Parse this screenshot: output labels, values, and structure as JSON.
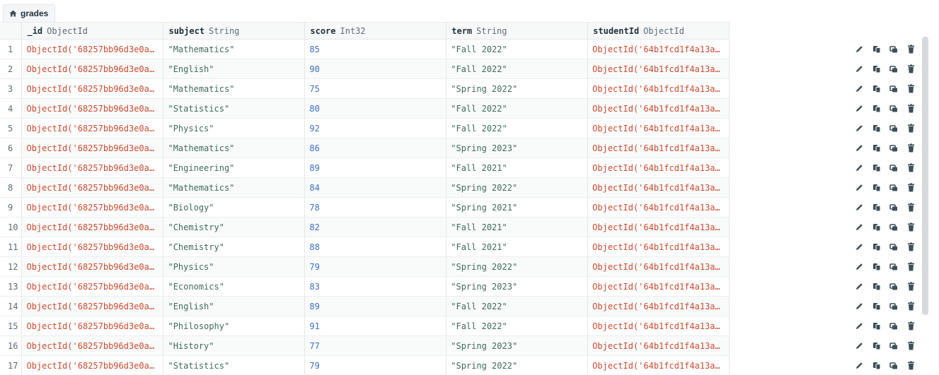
{
  "tab": {
    "label": "grades",
    "icon": "house-icon"
  },
  "columns": [
    {
      "field": "_id",
      "type": "ObjectId"
    },
    {
      "field": "subject",
      "type": "String"
    },
    {
      "field": "score",
      "type": "Int32"
    },
    {
      "field": "term",
      "type": "String"
    },
    {
      "field": "studentId",
      "type": "ObjectId"
    }
  ],
  "rows": [
    {
      "n": "1",
      "id": "ObjectId('68257bb96d3e0a…",
      "subject": "\"Mathematics\"",
      "score": "85",
      "term": "\"Fall 2022\"",
      "studentId": "ObjectId('64b1fcd1f4a13a…"
    },
    {
      "n": "2",
      "id": "ObjectId('68257bb96d3e0a…",
      "subject": "\"English\"",
      "score": "90",
      "term": "\"Fall 2022\"",
      "studentId": "ObjectId('64b1fcd1f4a13a…"
    },
    {
      "n": "3",
      "id": "ObjectId('68257bb96d3e0a…",
      "subject": "\"Mathematics\"",
      "score": "75",
      "term": "\"Spring 2022\"",
      "studentId": "ObjectId('64b1fcd1f4a13a…"
    },
    {
      "n": "4",
      "id": "ObjectId('68257bb96d3e0a…",
      "subject": "\"Statistics\"",
      "score": "80",
      "term": "\"Fall 2022\"",
      "studentId": "ObjectId('64b1fcd1f4a13a…"
    },
    {
      "n": "5",
      "id": "ObjectId('68257bb96d3e0a…",
      "subject": "\"Physics\"",
      "score": "92",
      "term": "\"Fall 2022\"",
      "studentId": "ObjectId('64b1fcd1f4a13a…"
    },
    {
      "n": "6",
      "id": "ObjectId('68257bb96d3e0a…",
      "subject": "\"Mathematics\"",
      "score": "86",
      "term": "\"Spring 2023\"",
      "studentId": "ObjectId('64b1fcd1f4a13a…"
    },
    {
      "n": "7",
      "id": "ObjectId('68257bb96d3e0a…",
      "subject": "\"Engineering\"",
      "score": "89",
      "term": "\"Fall 2021\"",
      "studentId": "ObjectId('64b1fcd1f4a13a…"
    },
    {
      "n": "8",
      "id": "ObjectId('68257bb96d3e0a…",
      "subject": "\"Mathematics\"",
      "score": "84",
      "term": "\"Spring 2022\"",
      "studentId": "ObjectId('64b1fcd1f4a13a…"
    },
    {
      "n": "9",
      "id": "ObjectId('68257bb96d3e0a…",
      "subject": "\"Biology\"",
      "score": "78",
      "term": "\"Spring 2021\"",
      "studentId": "ObjectId('64b1fcd1f4a13a…"
    },
    {
      "n": "10",
      "id": "ObjectId('68257bb96d3e0a…",
      "subject": "\"Chemistry\"",
      "score": "82",
      "term": "\"Fall 2021\"",
      "studentId": "ObjectId('64b1fcd1f4a13a…"
    },
    {
      "n": "11",
      "id": "ObjectId('68257bb96d3e0a…",
      "subject": "\"Chemistry\"",
      "score": "88",
      "term": "\"Fall 2021\"",
      "studentId": "ObjectId('64b1fcd1f4a13a…"
    },
    {
      "n": "12",
      "id": "ObjectId('68257bb96d3e0a…",
      "subject": "\"Physics\"",
      "score": "79",
      "term": "\"Spring 2022\"",
      "studentId": "ObjectId('64b1fcd1f4a13a…"
    },
    {
      "n": "13",
      "id": "ObjectId('68257bb96d3e0a…",
      "subject": "\"Economics\"",
      "score": "83",
      "term": "\"Spring 2023\"",
      "studentId": "ObjectId('64b1fcd1f4a13a…"
    },
    {
      "n": "14",
      "id": "ObjectId('68257bb96d3e0a…",
      "subject": "\"English\"",
      "score": "89",
      "term": "\"Fall 2022\"",
      "studentId": "ObjectId('64b1fcd1f4a13a…"
    },
    {
      "n": "15",
      "id": "ObjectId('68257bb96d3e0a…",
      "subject": "\"Philosophy\"",
      "score": "91",
      "term": "\"Fall 2022\"",
      "studentId": "ObjectId('64b1fcd1f4a13a…"
    },
    {
      "n": "16",
      "id": "ObjectId('68257bb96d3e0a…",
      "subject": "\"History\"",
      "score": "77",
      "term": "\"Spring 2023\"",
      "studentId": "ObjectId('64b1fcd1f4a13a…"
    },
    {
      "n": "17",
      "id": "ObjectId('68257bb96d3e0a…",
      "subject": "\"Statistics\"",
      "score": "79",
      "term": "\"Spring 2022\"",
      "studentId": "ObjectId('64b1fcd1f4a13a…"
    }
  ],
  "row_actions": [
    "edit-icon",
    "copy-icon",
    "clone-icon",
    "delete-icon"
  ],
  "colors": {
    "objectid": "#cf4a2f",
    "string": "#3e6a5a",
    "int": "#3b6ec9"
  }
}
